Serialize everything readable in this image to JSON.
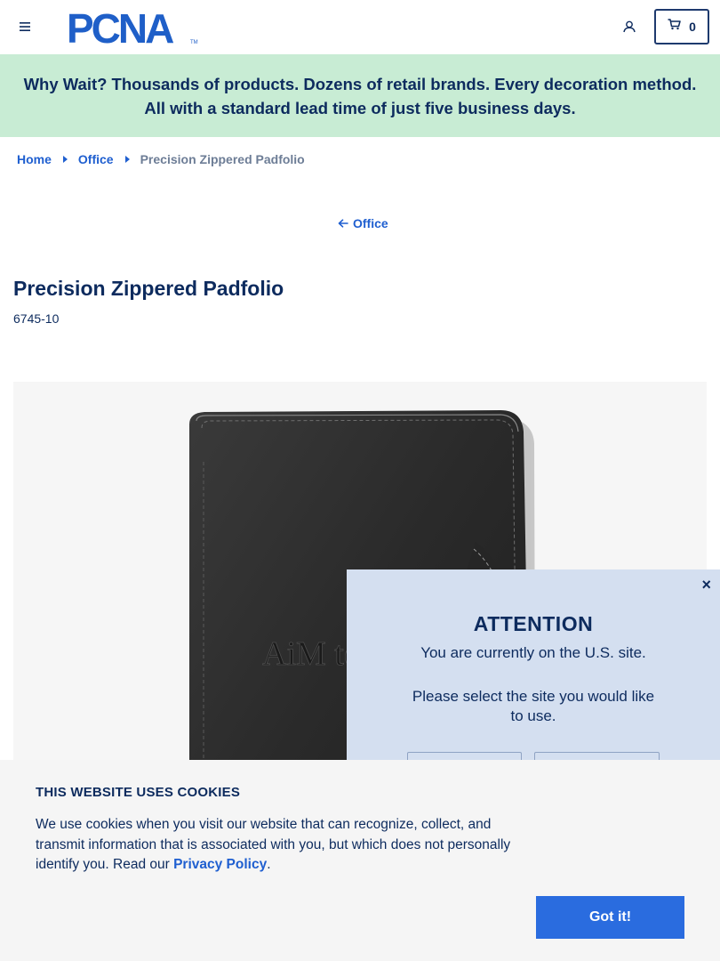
{
  "header": {
    "logo_text": "PCNA",
    "cart_count": "0"
  },
  "promo": {
    "text": "Why Wait? Thousands of products. Dozens of retail brands. Every decoration method. All with a standard lead time of just five business days."
  },
  "breadcrumb": {
    "items": [
      "Home",
      "Office"
    ],
    "current": "Precision Zippered Padfolio"
  },
  "back_link": {
    "label": "Office"
  },
  "product": {
    "title": "Precision Zippered Padfolio",
    "sku": "6745-10",
    "image_alt": "Black leather zippered padfolio with debossed logo",
    "deboss_logo_text": "AiM technolog"
  },
  "attention": {
    "title": "ATTENTION",
    "message": "You are currently on the U.S. site.",
    "prompt": "Please select the site you would like to use.",
    "close": "×"
  },
  "cookie": {
    "title": "THIS WEBSITE USES COOKIES",
    "text_before": "We use cookies when you visit our website that can recognize, collect, and transmit information that is associated with you, but which does not personally identify you. Read our ",
    "link": "Privacy Policy",
    "text_after": ".",
    "button": "Got it!"
  },
  "colors": {
    "navy": "#0d2b5e",
    "link_blue": "#1f5fd0",
    "promo_bg": "#c8ecd4",
    "modal_bg": "#d4dff0",
    "cookie_button": "#2a6cdf"
  }
}
